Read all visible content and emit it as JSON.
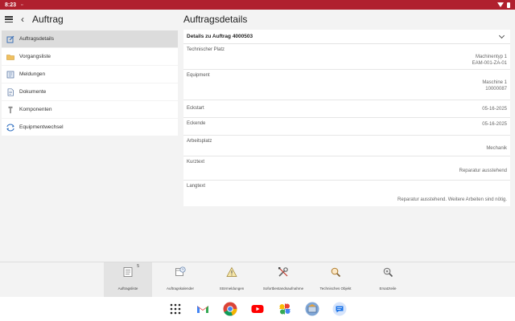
{
  "status": {
    "time": "8:23",
    "signal": "▫"
  },
  "header": {
    "title": "Auftrag"
  },
  "sidebar": {
    "items": [
      {
        "label": "Auftragsdetails",
        "icon": "edit-icon",
        "active": true
      },
      {
        "label": "Vorgangsliste",
        "icon": "folder-icon"
      },
      {
        "label": "Meldungen",
        "icon": "notification-icon"
      },
      {
        "label": "Dokumente",
        "icon": "document-icon"
      },
      {
        "label": "Komponenten",
        "icon": "component-icon"
      },
      {
        "label": "Equipmentwechsel",
        "icon": "swap-icon"
      }
    ]
  },
  "details": {
    "title": "Auftragsdetails",
    "section_title": "Details zu Auftrag 4000503",
    "fields": {
      "tech_place": {
        "label": "Technischer Platz",
        "value1": "Machinentyp 1",
        "value2": "EAM-001-ZA-01"
      },
      "equipment": {
        "label": "Equipment",
        "value1": "Maschine 1",
        "value2": "10000087"
      },
      "eckstart": {
        "label": "Eckstart",
        "value": "05-16-2025"
      },
      "eckende": {
        "label": "Eckende",
        "value": "05-16-2025"
      },
      "arbeitsplatz": {
        "label": "Arbeitsplatz",
        "value": "Mechanik"
      },
      "kurztext": {
        "label": "Kurztext",
        "value": "Reparatur ausstehend"
      },
      "langtext": {
        "label": "Langtext",
        "value": "Reparatur ausstehend. Weitere Arbeiten sind nötig."
      }
    }
  },
  "tabs": [
    {
      "label": "Auftragsliste",
      "badge": "5",
      "icon": "order-list-icon",
      "active": true
    },
    {
      "label": "Auftragskalender",
      "icon": "calendar-icon"
    },
    {
      "label": "Störmeldungen",
      "icon": "warning-icon"
    },
    {
      "label": "Sofortbestandsaufnahme",
      "icon": "tools-icon"
    },
    {
      "label": "Technisches Objekt",
      "icon": "magnifier-icon"
    },
    {
      "label": "Ersatzteile",
      "icon": "search-part-icon"
    }
  ],
  "colors": {
    "accent": "#b0202e"
  }
}
